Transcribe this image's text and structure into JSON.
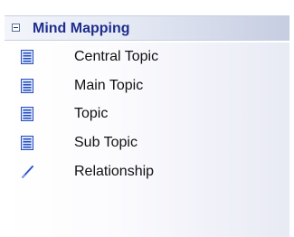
{
  "toolbox": {
    "section_title": "Mind Mapping",
    "items": [
      {
        "label": "Central Topic",
        "icon": "topic-icon"
      },
      {
        "label": "Main Topic",
        "icon": "topic-icon"
      },
      {
        "label": "Topic",
        "icon": "topic-icon"
      },
      {
        "label": "Sub Topic",
        "icon": "topic-icon"
      },
      {
        "label": "Relationship",
        "icon": "relationship-line-icon"
      }
    ]
  },
  "colors": {
    "header_title": "#1e2d8e",
    "topic_icon_border": "#2a4bb8",
    "topic_icon_fill": "#d7e7ff",
    "relationship_icon": "#2f55c9"
  }
}
